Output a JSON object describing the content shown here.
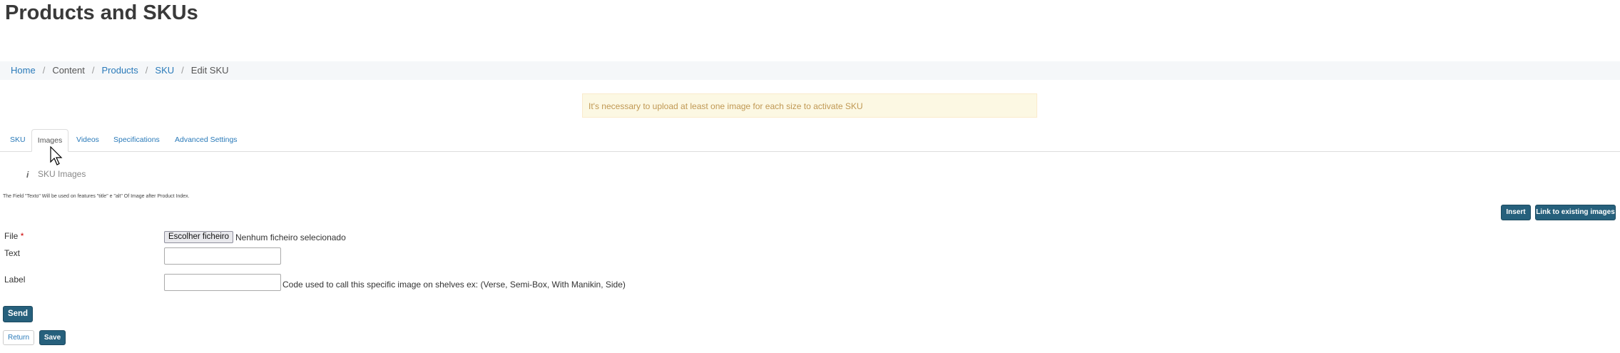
{
  "page": {
    "title": "Products and SKUs"
  },
  "breadcrumb": {
    "items": [
      {
        "label": "Home",
        "link": true
      },
      {
        "label": "Content",
        "link": false
      },
      {
        "label": "Products",
        "link": true
      },
      {
        "label": "SKU",
        "link": true
      },
      {
        "label": "Edit SKU",
        "link": false
      }
    ]
  },
  "alert": {
    "text": "It's necessary to upload at least one image for each size to activate SKU"
  },
  "tabs": [
    {
      "label": "SKU",
      "active": false
    },
    {
      "label": "Images",
      "active": true
    },
    {
      "label": "Videos",
      "active": false
    },
    {
      "label": "Specifications",
      "active": false
    },
    {
      "label": "Advanced Settings",
      "active": false
    }
  ],
  "section": {
    "title": "SKU Images",
    "icon": "i"
  },
  "note": "The Field \"Texto\" Will be used on features \"title\" e \"alt\" Of Image after Product Index.",
  "actions": {
    "insert_label": "Insert",
    "link_label": "Link to existing images"
  },
  "form": {
    "file_label": "File",
    "required_mark": "*",
    "file_button": "Escolher ficheiro",
    "file_status": "Nenhum ficheiro selecionado",
    "text_label": "Text",
    "text_value": "",
    "label_label": "Label",
    "label_value": "",
    "label_help": "Code used to call this specific image on shelves ex: (Verse, Semi-Box, With Manikin, Side)"
  },
  "buttons": {
    "send": "Send",
    "return": "Return",
    "save": "Save"
  },
  "colors": {
    "primary": "#26607c",
    "link": "#2a7ab9",
    "alert_bg": "#fcf8e3",
    "alert_text": "#c09853"
  }
}
